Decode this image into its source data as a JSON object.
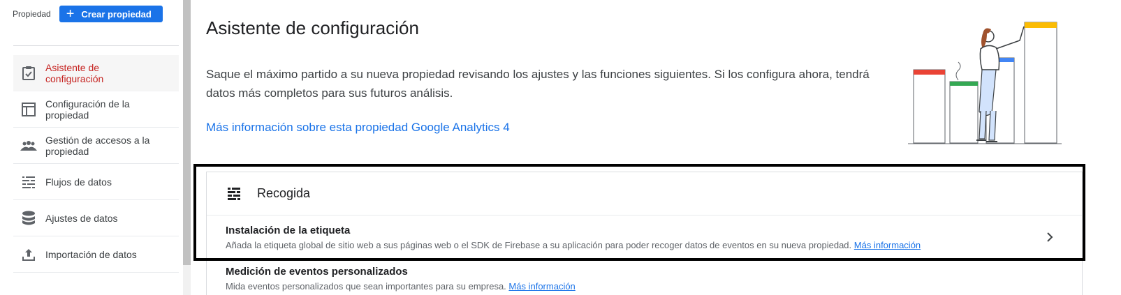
{
  "sidebar": {
    "property_label": "Propiedad",
    "create_button": "Crear propiedad",
    "items": [
      {
        "label": "Asistente de configuración",
        "icon": "checklist-icon",
        "active": true
      },
      {
        "label": "Configuración de la propiedad",
        "icon": "property-settings-icon",
        "active": false
      },
      {
        "label": "Gestión de accesos a la propiedad",
        "icon": "people-icon",
        "active": false
      },
      {
        "label": "Flujos de datos",
        "icon": "data-streams-icon",
        "active": false
      },
      {
        "label": "Ajustes de datos",
        "icon": "database-icon",
        "active": false
      },
      {
        "label": "Importación de datos",
        "icon": "upload-icon",
        "active": false
      }
    ]
  },
  "main": {
    "title": "Asistente de configuración",
    "intro": "Saque el máximo partido a su nueva propiedad revisando los ajustes y las funciones siguientes. Si los configura ahora, tendrá datos más completos para sus futuros análisis.",
    "learn_more": "Más información sobre esta propiedad Google Analytics 4"
  },
  "card": {
    "title": "Recogida",
    "icon": "collection-icon",
    "rows": [
      {
        "title": "Instalación de la etiqueta",
        "desc": "Añada la etiqueta global de sitio web a sus páginas web o el SDK de Firebase a su aplicación para poder recoger datos de eventos en su nueva propiedad.",
        "link": "Más información"
      },
      {
        "title": "Medición de eventos personalizados",
        "desc": "Mida eventos personalizados que sean importantes para su empresa.",
        "link": "Más información"
      }
    ]
  },
  "colors": {
    "accent": "#1a73e8",
    "active_text": "#c5221f",
    "bar_red": "#ea4335",
    "bar_green": "#34a853",
    "bar_blue": "#4285f4",
    "bar_yellow": "#fbbc04"
  }
}
